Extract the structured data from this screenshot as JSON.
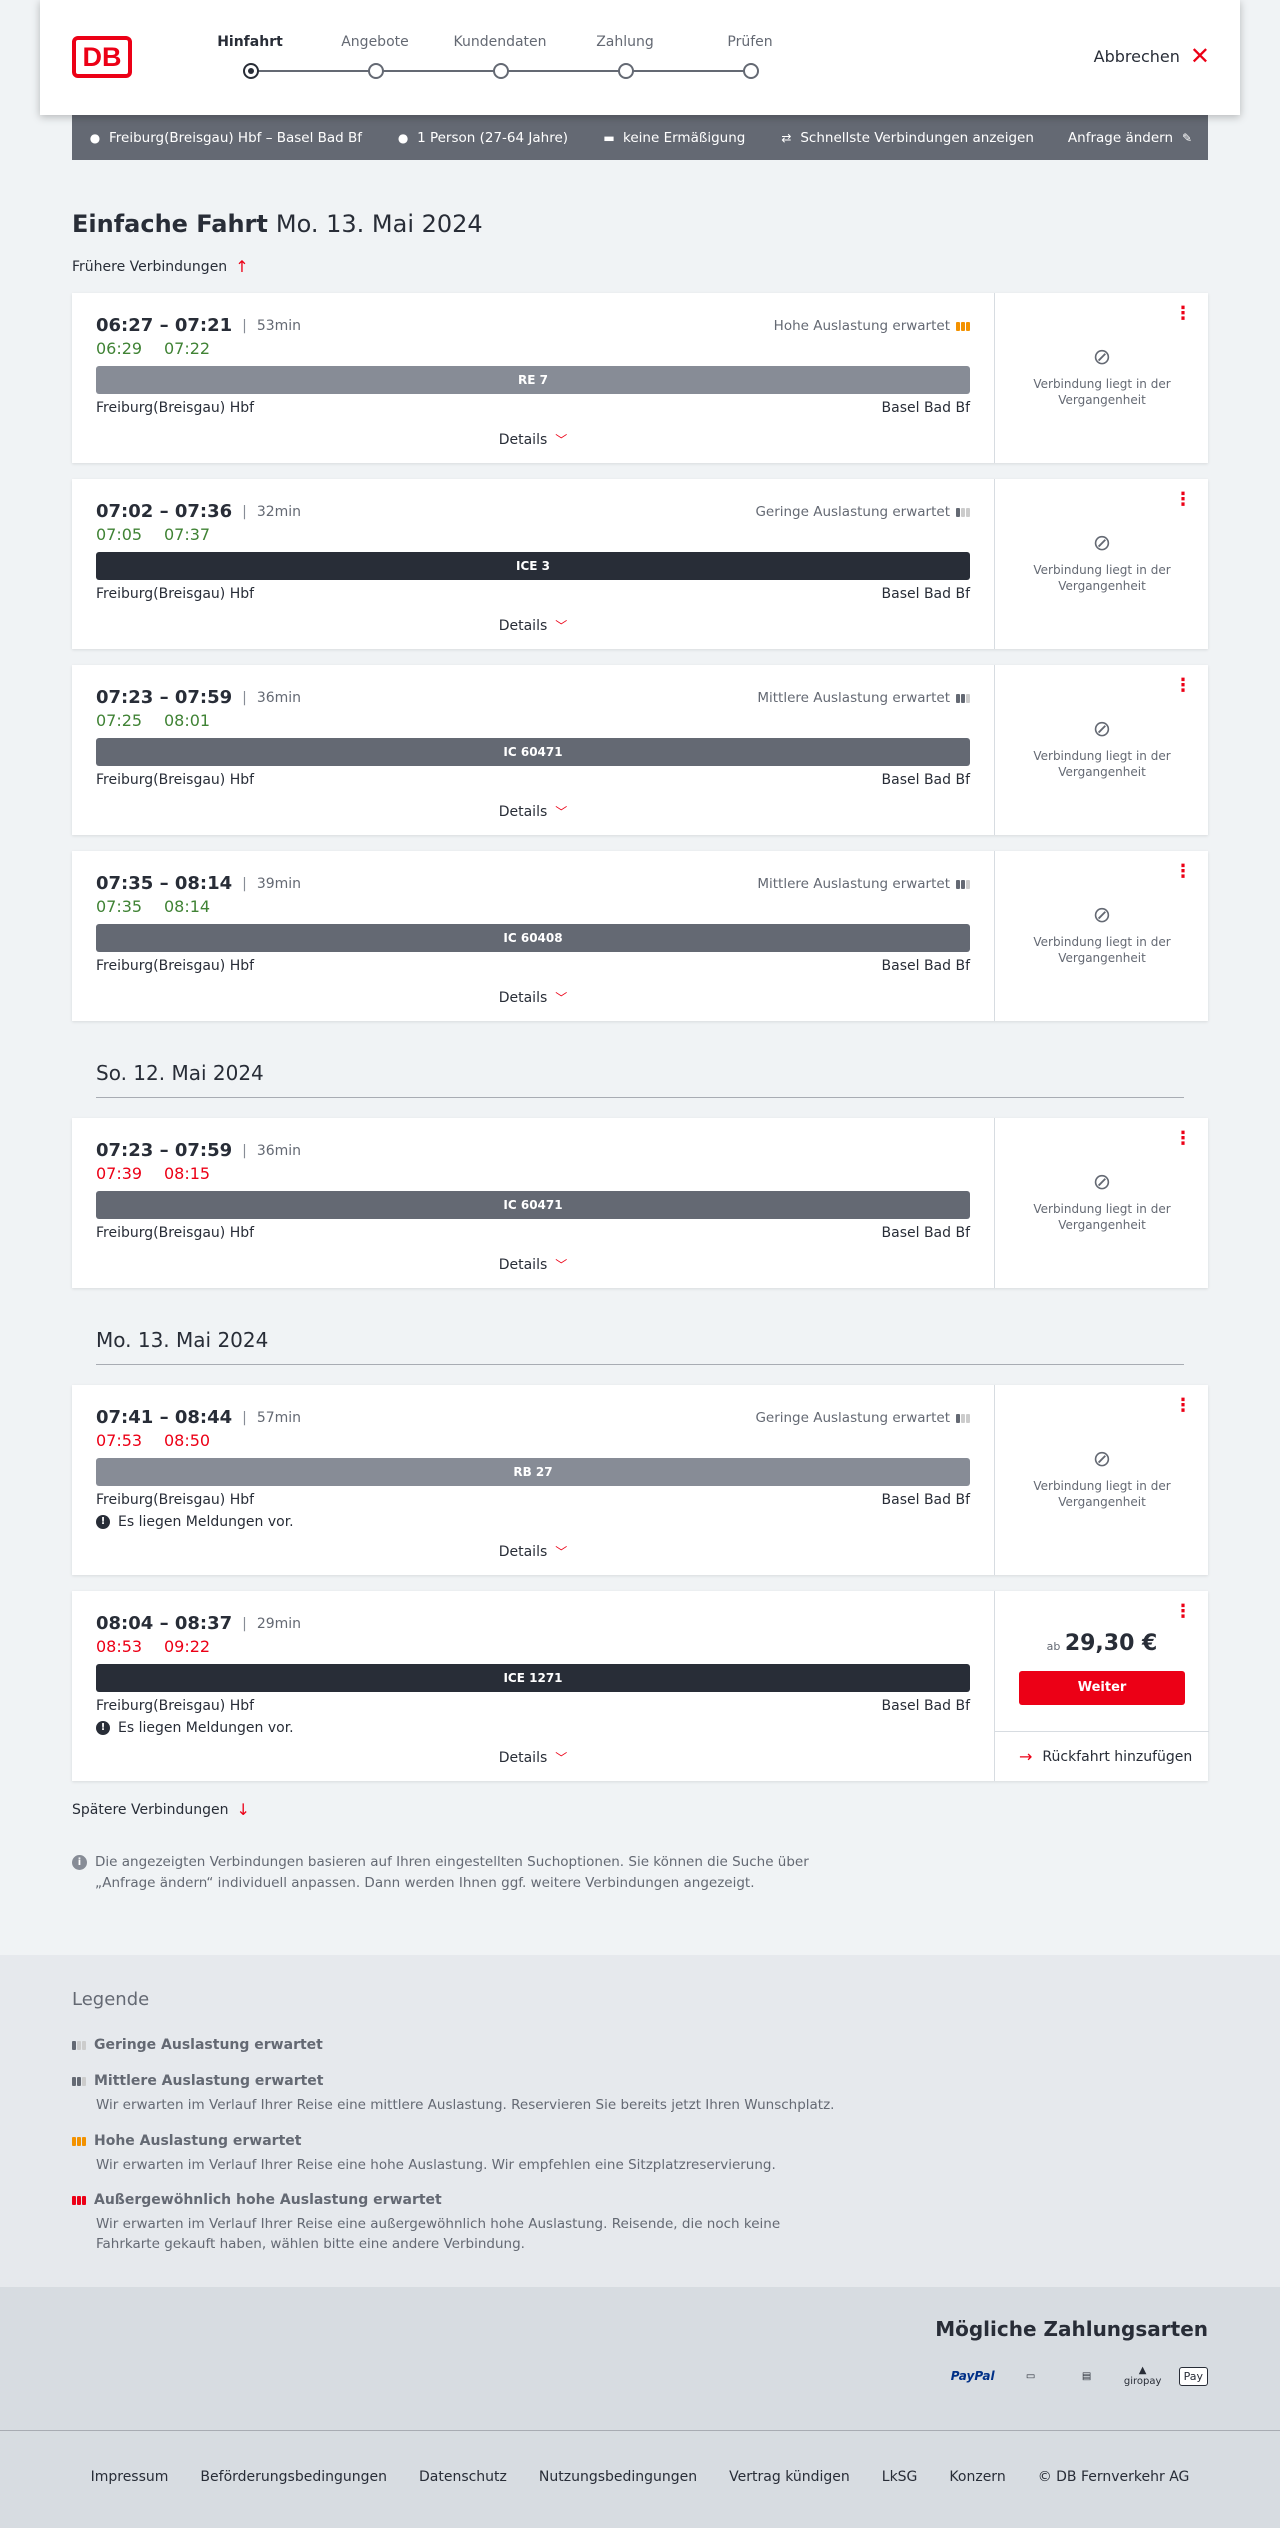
{
  "header": {
    "logo": "DB",
    "steps": [
      "Hinfahrt",
      "Angebote",
      "Kundendaten",
      "Zahlung",
      "Prüfen"
    ],
    "active_step": 0,
    "cancel_label": "Abbrechen"
  },
  "summary": {
    "route": "Freiburg(Breisgau) Hbf – Basel Bad Bf",
    "passengers": "1 Person (27-64 Jahre)",
    "discount": "keine Ermäßigung",
    "option": "Schnellste Verbindungen anzeigen",
    "edit_label": "Anfrage ändern"
  },
  "page": {
    "title": "Einfache Fahrt",
    "date": "Mo. 13. Mai 2024",
    "earlier_label": "Frühere Verbindungen",
    "later_label": "Spätere Verbindungen"
  },
  "sections": {
    "sunday": "So. 12. Mai 2024",
    "monday": "Mo. 13. Mai 2024"
  },
  "connections": [
    {
      "time": "06:27 – 07:21",
      "duration": "53min",
      "rt_dep": "06:29",
      "rt_arr": "07:22",
      "rt_color": "green",
      "load": "Hohe Auslastung erwartet",
      "load_level": "high",
      "train": "RE 7",
      "train_color": "#878c96",
      "from": "Freiburg(Breisgau) Hbf",
      "to": "Basel Bad Bf",
      "details": "Details",
      "cart_text": "Verbindung liegt in der Vergangenheit"
    },
    {
      "time": "07:02 – 07:36",
      "duration": "32min",
      "rt_dep": "07:05",
      "rt_arr": "07:37",
      "rt_color": "green",
      "load": "Geringe Auslastung erwartet",
      "load_level": "low",
      "train": "ICE 3",
      "train_color": "#282d37",
      "from": "Freiburg(Breisgau) Hbf",
      "to": "Basel Bad Bf",
      "details": "Details",
      "cart_text": "Verbindung liegt in der Vergangenheit"
    },
    {
      "time": "07:23 – 07:59",
      "duration": "36min",
      "rt_dep": "07:25",
      "rt_arr": "08:01",
      "rt_color": "green",
      "load": "Mittlere Auslastung erwartet",
      "load_level": "medium",
      "train": "IC 60471",
      "train_color": "#646973",
      "from": "Freiburg(Breisgau) Hbf",
      "to": "Basel Bad Bf",
      "details": "Details",
      "cart_text": "Verbindung liegt in der Vergangenheit"
    },
    {
      "time": "07:35 – 08:14",
      "duration": "39min",
      "rt_dep": "07:35",
      "rt_arr": "08:14",
      "rt_color": "green",
      "load": "Mittlere Auslastung erwartet",
      "load_level": "medium",
      "train": "IC 60408",
      "train_color": "#646973",
      "from": "Freiburg(Breisgau) Hbf",
      "to": "Basel Bad Bf",
      "details": "Details",
      "cart_text": "Verbindung liegt in der Vergangenheit"
    },
    {
      "time": "07:23 – 07:59",
      "duration": "36min",
      "rt_dep": "07:39",
      "rt_arr": "08:15",
      "rt_color": "red",
      "load": "",
      "load_level": "",
      "train": "IC 60471",
      "train_color": "#646973",
      "from": "Freiburg(Breisgau) Hbf",
      "to": "Basel Bad Bf",
      "details": "Details",
      "cart_text": "Verbindung liegt in der Vergangenheit"
    },
    {
      "time": "07:41 – 08:44",
      "duration": "57min",
      "rt_dep": "07:53",
      "rt_arr": "08:50",
      "rt_color": "red",
      "load": "Geringe Auslastung erwartet",
      "load_level": "low",
      "train": "RB 27",
      "train_color": "#878c96",
      "from": "Freiburg(Breisgau) Hbf",
      "to": "Basel Bad Bf",
      "message": "Es liegen Meldungen vor.",
      "details": "Details",
      "cart_text": "Verbindung liegt in der Vergangenheit"
    },
    {
      "time": "08:04 – 08:37",
      "duration": "29min",
      "rt_dep": "08:53",
      "rt_arr": "09:22",
      "rt_color": "red",
      "load": "",
      "load_level": "",
      "train": "ICE 1271",
      "train_color": "#282d37",
      "from": "Freiburg(Breisgau) Hbf",
      "to": "Basel Bad Bf",
      "message": "Es liegen Meldungen vor.",
      "details": "Details",
      "price_prefix": "ab",
      "price": "29,30 €",
      "button": "Weiter",
      "return_label": "Rückfahrt hinzufügen"
    }
  ],
  "info_text": "Die angezeigten Verbindungen basieren auf Ihren eingestellten Suchoptionen. Sie können die Suche über „Anfrage ändern“ individuell anpassen. Dann werden Ihnen ggf. weitere Verbindungen angezeigt.",
  "legend": {
    "title": "Legende",
    "items": [
      {
        "label": "Geringe Auslastung erwartet",
        "desc": ""
      },
      {
        "label": "Mittlere Auslastung erwartet",
        "desc": "Wir erwarten im Verlauf Ihrer Reise eine mittlere Auslastung. Reservieren Sie bereits jetzt Ihren Wunschplatz."
      },
      {
        "label": "Hohe Auslastung erwartet",
        "desc": "Wir erwarten im Verlauf Ihrer Reise eine hohe Auslastung. Wir empfehlen eine Sitzplatzreservierung."
      },
      {
        "label": "Außergewöhnlich hohe Auslastung erwartet",
        "desc": "Wir erwarten im Verlauf Ihrer Reise eine außergewöhnlich hohe Auslastung. Reisende, die noch keine Fahrkarte gekauft haben, wählen bitte eine andere Verbindung."
      }
    ]
  },
  "payment": {
    "title": "Mögliche Zahlungsarten",
    "methods": [
      "PayPal",
      "Kreditkarte",
      "SEPA",
      "giropay",
      "Pay"
    ]
  },
  "footer": {
    "links": [
      "Impressum",
      "Beförderungsbedingungen",
      "Datenschutz",
      "Nutzungsbedingungen",
      "Vertrag kündigen",
      "LkSG",
      "Konzern",
      "© DB Fernverkehr AG"
    ]
  },
  "colors": {
    "brand_red": "#ec0016",
    "realtime_green": "#408335",
    "load_high": "#f39200"
  }
}
